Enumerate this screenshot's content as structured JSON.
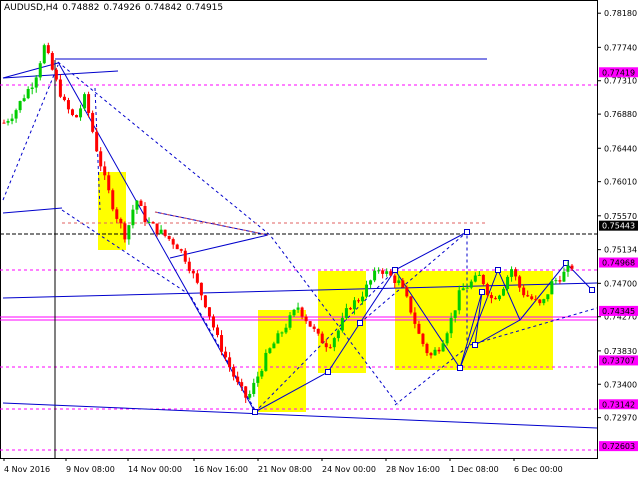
{
  "header": {
    "symbol": "AUDUSD,H4",
    "open": "0.74882",
    "high": "0.74926",
    "low": "0.74842",
    "close": "0.74915"
  },
  "price_axis": {
    "ticks": [
      "0.78180",
      "0.77740",
      "0.77310",
      "0.76880",
      "0.76440",
      "0.76010",
      "0.75570",
      "0.75134",
      "0.74700",
      "0.74270",
      "0.73830",
      "0.73400",
      "0.72970"
    ]
  },
  "time_axis": {
    "ticks": [
      "4 Nov 2016",
      "9 Nov 08:00",
      "14 Nov 00:00",
      "16 Nov 16:00",
      "21 Nov 08:00",
      "24 Nov 00:00",
      "28 Nov 16:00",
      "1 Dec 08:00",
      "6 Dec 00:00"
    ]
  },
  "price_tags": [
    {
      "label": "0.77419",
      "color": "#ff00ff"
    },
    {
      "label": "0.75443",
      "color": "#000000"
    },
    {
      "label": "0.74968",
      "color": "#ff00ff"
    },
    {
      "label": "0.74345",
      "color": "#ff00ff"
    },
    {
      "label": "0.73707",
      "color": "#ff00ff"
    },
    {
      "label": "0.73142",
      "color": "#ff00ff"
    },
    {
      "label": "0.72603",
      "color": "#ff00ff"
    }
  ],
  "colors": {
    "bull": "#00cc00",
    "bear": "#ff0000",
    "zone": "#ffff00",
    "line": "#0000cc",
    "magenta": "#ff00ff",
    "sale_line": "#000000",
    "dashed_pink": "#e06060"
  },
  "chart_data": {
    "type": "candlestick",
    "title": "AUDUSD,H4",
    "ylim": [
      0.7245,
      0.7835
    ],
    "x_labels": [
      "4 Nov 2016",
      "9 Nov 08:00",
      "14 Nov 00:00",
      "16 Nov 16:00",
      "21 Nov 08:00",
      "24 Nov 00:00",
      "28 Nov 16:00",
      "1 Dec 08:00",
      "6 Dec 00:00"
    ],
    "horizontal_levels": [
      0.77419,
      0.75443,
      0.74968,
      0.74345,
      0.73707,
      0.73142,
      0.72603
    ],
    "path": [
      0.7677,
      0.769,
      0.7712,
      0.7732,
      0.7776,
      0.7735,
      0.77,
      0.768,
      0.771,
      0.765,
      0.76,
      0.756,
      0.753,
      0.758,
      0.755,
      0.754,
      0.753,
      0.752,
      0.75,
      0.747,
      0.744,
      0.74,
      0.737,
      0.734,
      0.732,
      0.735,
      0.738,
      0.74,
      0.742,
      0.744,
      0.742,
      0.74,
      0.739,
      0.741,
      0.744,
      0.745,
      0.747,
      0.749,
      0.748,
      0.747,
      0.744,
      0.74,
      0.7375,
      0.739,
      0.742,
      0.746,
      0.747,
      0.748,
      0.745,
      0.746,
      0.749,
      0.746,
      0.745,
      0.744,
      0.747,
      0.748,
      0.7492
    ]
  }
}
